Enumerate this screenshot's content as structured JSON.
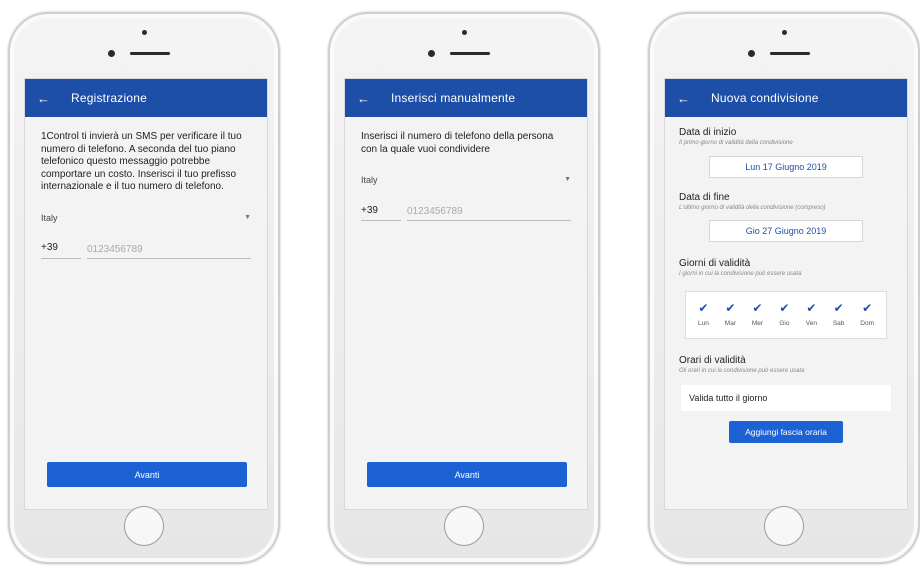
{
  "screens": [
    {
      "title": "Registrazione",
      "back_icon": "arrow-left-icon",
      "description": "1Control ti invierà un SMS per verificare il tuo numero di telefono. A seconda del tuo piano telefonico questo messaggio potrebbe comportare un costo. Inserisci il tuo prefisso internazionale e il tuo numero di telefono.",
      "country": "Italy",
      "prefix": "+39",
      "phone_placeholder": "0123456789",
      "button_label": "Avanti"
    },
    {
      "title": "Inserisci manualmente",
      "back_icon": "arrow-left-icon",
      "description": "Inserisci il numero di telefono della persona con la quale vuoi condividere",
      "country": "Italy",
      "prefix": "+39",
      "phone_placeholder": "0123456789",
      "button_label": "Avanti"
    },
    {
      "title": "Nuova condivisione",
      "back_icon": "arrow-left-icon",
      "start": {
        "label": "Data di inizio",
        "hint": "Il primo giorno di validità della condivisione",
        "value": "Lun 17 Giugno 2019"
      },
      "end": {
        "label": "Data di fine",
        "hint": "L'ultimo giorno di validità della condivisione (compreso)",
        "value": "Gio 27 Giugno 2019"
      },
      "validity_days": {
        "label": "Giorni di validità",
        "hint": "I giorni in cui la condivisione può essere usata",
        "days": [
          {
            "label": "Lun",
            "checked": true
          },
          {
            "label": "Mar",
            "checked": true
          },
          {
            "label": "Mer",
            "checked": true
          },
          {
            "label": "Gio",
            "checked": true
          },
          {
            "label": "Ven",
            "checked": true
          },
          {
            "label": "Sab",
            "checked": true
          },
          {
            "label": "Dom",
            "checked": true
          }
        ]
      },
      "validity_hours": {
        "label": "Orari di validità",
        "hint": "Gli orari in cui la condivisione può essere usata",
        "value": "Valida tutto il giorno"
      },
      "add_button_label": "Aggiungi fascia oraria"
    }
  ],
  "colors": {
    "appbar": "#1e4fa8",
    "button": "#1c62d4",
    "screen_bg": "#f3f3f3"
  }
}
